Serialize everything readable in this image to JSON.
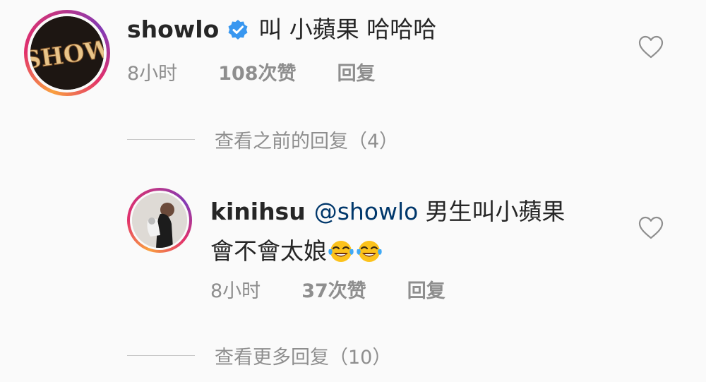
{
  "comment": {
    "username": "showlo",
    "text": "叫 小蘋果 哈哈哈",
    "time": "8小时",
    "likes": "108次赞",
    "reply_label": "回复",
    "avatar_text": "SHOW"
  },
  "view_previous": "查看之前的回复（4）",
  "reply": {
    "username": "kinihsu",
    "mention": "@showlo",
    "text_line1": "男生叫小蘋果",
    "text_line2": "會不會太娘",
    "time": "8小时",
    "likes": "37次赞",
    "reply_label": "回复"
  },
  "view_more": "查看更多回复（10）",
  "icons": {
    "verified": "verified-badge-icon",
    "heart": "heart-outline-icon",
    "emoji": "face-with-tears-of-joy"
  },
  "colors": {
    "background": "#fafafa",
    "text": "#262626",
    "secondary": "#8e8e8e",
    "mention": "#00376b",
    "verified": "#3897f0"
  }
}
